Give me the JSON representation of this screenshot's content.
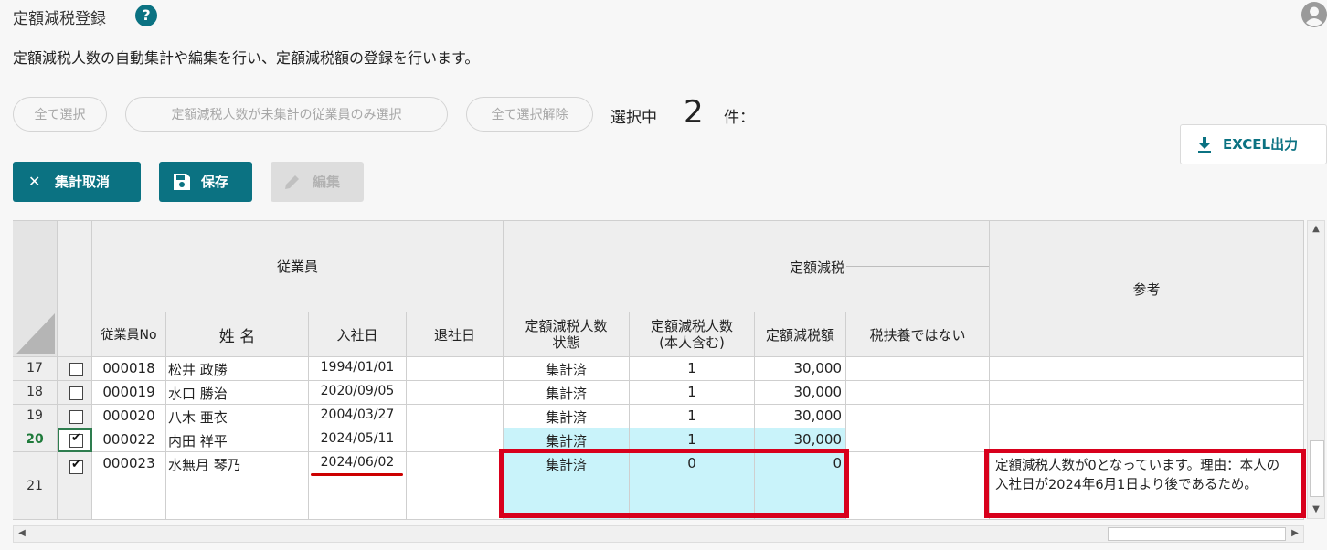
{
  "header": {
    "title": "定額減税登録",
    "help_icon": "question-circle-icon",
    "user_icon": "user-circle-icon",
    "description": "定額減税人数の自動集計や編集を行い、定額減税額の登録を行います。"
  },
  "selection": {
    "select_all_label": "全て選択",
    "select_uncounted_label": "定額減税人数が未集計の従業員のみ選択",
    "deselect_all_label": "全て選択解除",
    "selected_label": "選択中",
    "selected_count": "2",
    "selected_unit": "件："
  },
  "toolbar": {
    "cancel_label": "集計取消",
    "save_label": "保存",
    "edit_label": "編集",
    "excel_label": "EXCEL出力",
    "colors": {
      "accent": "#0b7282",
      "disabled": "#dddddd",
      "highlight": "#c9f3fa",
      "annotation_red": "#d8001c"
    }
  },
  "grid": {
    "group_headers": {
      "employee": "従業員",
      "tax_cut": "定額減税",
      "reference": "参考"
    },
    "columns": {
      "emp_no": "従業員No",
      "name": "姓 名",
      "hire_date": "入社日",
      "leave_date": "退社日",
      "status": "定額減税人数\n状態",
      "count": "定額減税人数\n(本人含む)",
      "amount": "定額減税額",
      "not_dependent": "税扶養ではない"
    },
    "rows": [
      {
        "row_no": "17",
        "checked": false,
        "emp_no": "000018",
        "name": "松井 政勝",
        "hire_date": "1994/01/01",
        "leave_date": "",
        "status": "集計済",
        "count": "1",
        "amount": "30,000",
        "not_dependent": "",
        "note": ""
      },
      {
        "row_no": "18",
        "checked": false,
        "emp_no": "000019",
        "name": "水口 勝治",
        "hire_date": "2020/09/05",
        "leave_date": "",
        "status": "集計済",
        "count": "1",
        "amount": "30,000",
        "not_dependent": "",
        "note": ""
      },
      {
        "row_no": "19",
        "checked": false,
        "emp_no": "000020",
        "name": "八木 亜衣",
        "hire_date": "2004/03/27",
        "leave_date": "",
        "status": "集計済",
        "count": "1",
        "amount": "30,000",
        "not_dependent": "",
        "note": ""
      },
      {
        "row_no": "20",
        "checked": true,
        "emp_no": "000022",
        "name": "内田 祥平",
        "hire_date": "2024/05/11",
        "leave_date": "",
        "status": "集計済",
        "count": "1",
        "amount": "30,000",
        "not_dependent": "",
        "note": ""
      },
      {
        "row_no": "21",
        "checked": true,
        "emp_no": "000023",
        "name": "水無月 琴乃",
        "hire_date": "2024/06/02",
        "leave_date": "",
        "status": "集計済",
        "count": "0",
        "amount": "0",
        "not_dependent": "",
        "note": "定額減税人数が0となっています。理由：本人の入社日が2024年6月1日より後であるため。"
      }
    ]
  }
}
